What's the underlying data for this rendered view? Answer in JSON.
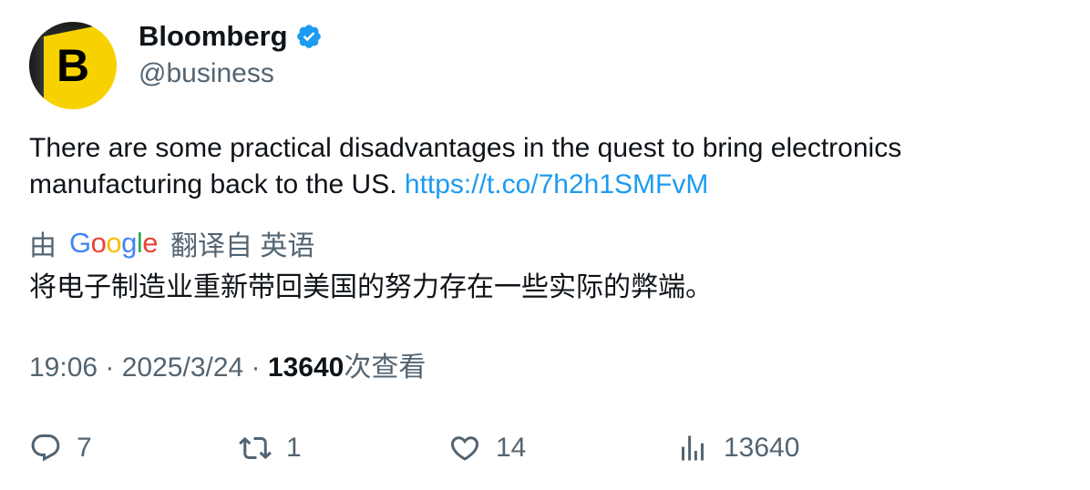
{
  "author": {
    "avatar_letter": "B",
    "name": "Bloomberg",
    "handle": "@business",
    "verified_icon": "verified-badge-icon"
  },
  "tweet": {
    "text": "There are some practical disadvantages in the quest to bring electronics manufacturing back to the US. ",
    "link": "https://t.co/7h2h1SMFvM"
  },
  "translation": {
    "prefix": "由",
    "provider": "Google",
    "suffix": "翻译自 英语",
    "text": "将电子制造业重新带回美国的努力存在一些实际的弊端。"
  },
  "meta": {
    "time": "19:06",
    "separator": " · ",
    "date": "2025/3/24",
    "views_count": "13640",
    "views_label": "次查看"
  },
  "actions": {
    "replies": "7",
    "retweets": "1",
    "likes": "14",
    "views": "13640"
  },
  "colors": {
    "link": "#1d9bf0",
    "muted": "#536471",
    "verified": "#1d9bf0",
    "avatar_bg": "#f8d200"
  }
}
